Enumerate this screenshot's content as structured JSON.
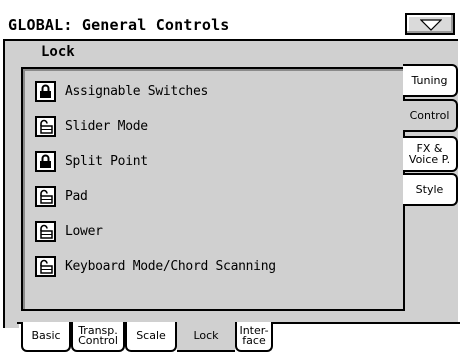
{
  "header": {
    "title": "GLOBAL: General Controls",
    "menu_icon": "triangle-down-icon"
  },
  "page": {
    "section_title": "Lock"
  },
  "lock_items": [
    {
      "label": "Assignable Switches",
      "locked": true
    },
    {
      "label": "Slider Mode",
      "locked": false
    },
    {
      "label": "Split Point",
      "locked": true
    },
    {
      "label": "Pad",
      "locked": false
    },
    {
      "label": "Lower",
      "locked": false
    },
    {
      "label": "Keyboard Mode/Chord Scanning",
      "locked": false
    }
  ],
  "side_tabs": [
    {
      "line1": "Tuning",
      "line2": "",
      "active": false
    },
    {
      "line1": "Control",
      "line2": "",
      "active": true
    },
    {
      "line1": "FX &",
      "line2": "Voice P.",
      "active": false
    },
    {
      "line1": "Style",
      "line2": "",
      "active": false
    }
  ],
  "bottom_tabs": [
    {
      "line1": "Basic",
      "line2": "",
      "active": false
    },
    {
      "line1": "Transp.",
      "line2": "Control",
      "active": false
    },
    {
      "line1": "Scale",
      "line2": "",
      "active": false
    },
    {
      "line1": "Lock",
      "line2": "",
      "active": true
    },
    {
      "line1": "Inter-",
      "line2": "face",
      "active": false
    }
  ]
}
